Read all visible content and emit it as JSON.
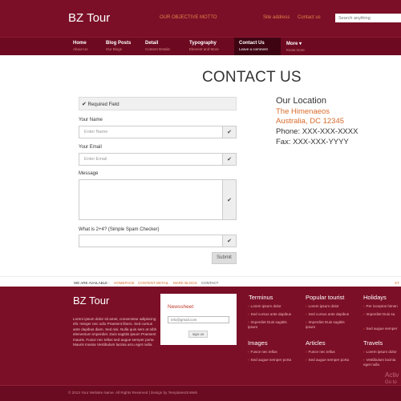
{
  "header": {
    "logo": "BZ Tour",
    "motto": "OUR OBJECTIVE MOTTO",
    "site_address": "Site address",
    "contact_us": "Contact us",
    "search_placeholder": "Search anything"
  },
  "nav": {
    "items": [
      {
        "title": "Home",
        "sub": "About Us"
      },
      {
        "title": "Blog Posts",
        "sub": "Our Blogs"
      },
      {
        "title": "Detail",
        "sub": "Content Details"
      },
      {
        "title": "Typography",
        "sub": "Element and More"
      },
      {
        "title": "Contact Us",
        "sub": "Leave a comment"
      },
      {
        "title": "More ▾",
        "sub": "Know more"
      }
    ]
  },
  "main": {
    "title": "CONTACT US",
    "required_label": "Required Field",
    "name_label": "Your Name",
    "name_placeholder": "Enter Name",
    "email_label": "Your Email",
    "email_placeholder": "Enter Email",
    "message_label": "Message",
    "spam_label": "What is 2+4? (Simple Spam Checker)",
    "submit": "Submit"
  },
  "location": {
    "title": "Our Location",
    "line1": "The Himenaeos",
    "line2": "Australia, DC 12345",
    "phone": "Phone: XXX-XXX-XXXX",
    "fax": "Fax: XXX-XXX-YYYY"
  },
  "available": {
    "label": "WE ARE AVAILABLE :",
    "links": [
      "HOMEPAGE",
      "CONTENT DETAIL",
      "MARK BLOGS",
      "CONTACT"
    ],
    "right_fragment": "ST"
  },
  "footer": {
    "logo": "BZ Tour",
    "about": "Lorem ipsum dolor sit amet, consectetur adipiscing elit. Integer nec odio Praesent libero. Sed cursus ante dapibus diam. Sed nisi. Nulla quis sem at nibh elementum imperdiet. Duis sagittis ipsum Praesent mauris. Fusce nec tellus sed augue semper porta Mauris massa Vestibulum lacinia arcu eget nulla.",
    "newsletter": {
      "title": "Newssheet",
      "email_value": "info@gmail.com",
      "button": "sign us"
    },
    "columns": [
      {
        "title": "Terminus",
        "items": [
          "Lorem ipsum dolor",
          "Sed cursus ante dapibus",
          "Imperdiet Duis sagittis ipsum"
        ]
      },
      {
        "title": "Popular tourist",
        "items": [
          "Lorem ipsum dolor",
          "Sed cursus ante dapibus",
          "Imperdiet Duis sagittis ipsum"
        ]
      },
      {
        "title": "Holidays",
        "items": [
          "Per inceptos himen",
          "Imperdiet Duis sa",
          "Sed augue semper"
        ]
      },
      {
        "title": "Images",
        "items": [
          "Fusce nec tellus",
          "Sed augue semper porta"
        ]
      },
      {
        "title": "Articles",
        "items": [
          "Fusce nec tellus",
          "Sed augue semper porta"
        ]
      },
      {
        "title": "Travels",
        "items": [
          "Lorem ipsum dolor",
          "Vestibulum lacinia eget nulla"
        ]
      }
    ],
    "watermark": "Activ",
    "watermark2": "Go to",
    "copyright": "© 2013 Your Website Name. All Rights Reserved | Design by TemplatesOnWeb"
  }
}
